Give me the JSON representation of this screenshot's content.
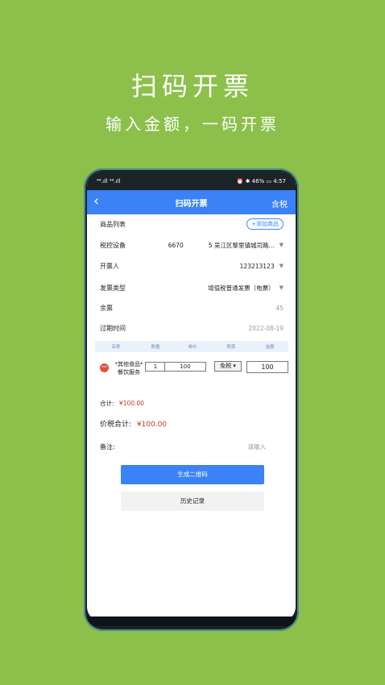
{
  "promo": {
    "headline": "扫码开票",
    "subline": "输入金额，一码开票"
  },
  "status_bar": {
    "left": "⁴⁶.ıll ⁴⁶.ıll",
    "right": "⏰ ✱ 46% ▭ 4:57"
  },
  "nav": {
    "back_icon": "chevron-left",
    "title": "扫码开票",
    "right_label": "含税"
  },
  "form": {
    "product_list_label": "商品列表",
    "add_product_label": "+添加商品",
    "tax_device_label": "税控设备",
    "tax_device_value": "6670             5 吴江区黎里镇城司路...",
    "drawer_label": "开票人",
    "drawer_value": "123213123",
    "invoice_type_label": "发票类型",
    "invoice_type_value": "增值税普通发票（电票）",
    "remaining_label": "余票",
    "remaining_value": "45",
    "expiry_label": "过期时间",
    "expiry_value": "2022-08-19"
  },
  "table": {
    "headers": [
      "名称",
      "数量",
      "单价",
      "税率",
      "金额"
    ],
    "item": {
      "name": "*其他食品*餐饮服务",
      "quantity": "1",
      "unit_price": "100",
      "tax_rate": "免税 ▾",
      "amount": "100"
    }
  },
  "totals": {
    "subtotal_label": "合计:",
    "subtotal_value": "¥100.00",
    "total_label": "价税合计:",
    "total_value": "¥100.00"
  },
  "remark": {
    "label": "备注:",
    "placeholder": "请输入"
  },
  "buttons": {
    "generate_qr": "生成二维码",
    "history": "历史记录"
  },
  "colors": {
    "background": "#8cc04b",
    "primary": "#3b82f6",
    "accent_red": "#c0392b"
  }
}
